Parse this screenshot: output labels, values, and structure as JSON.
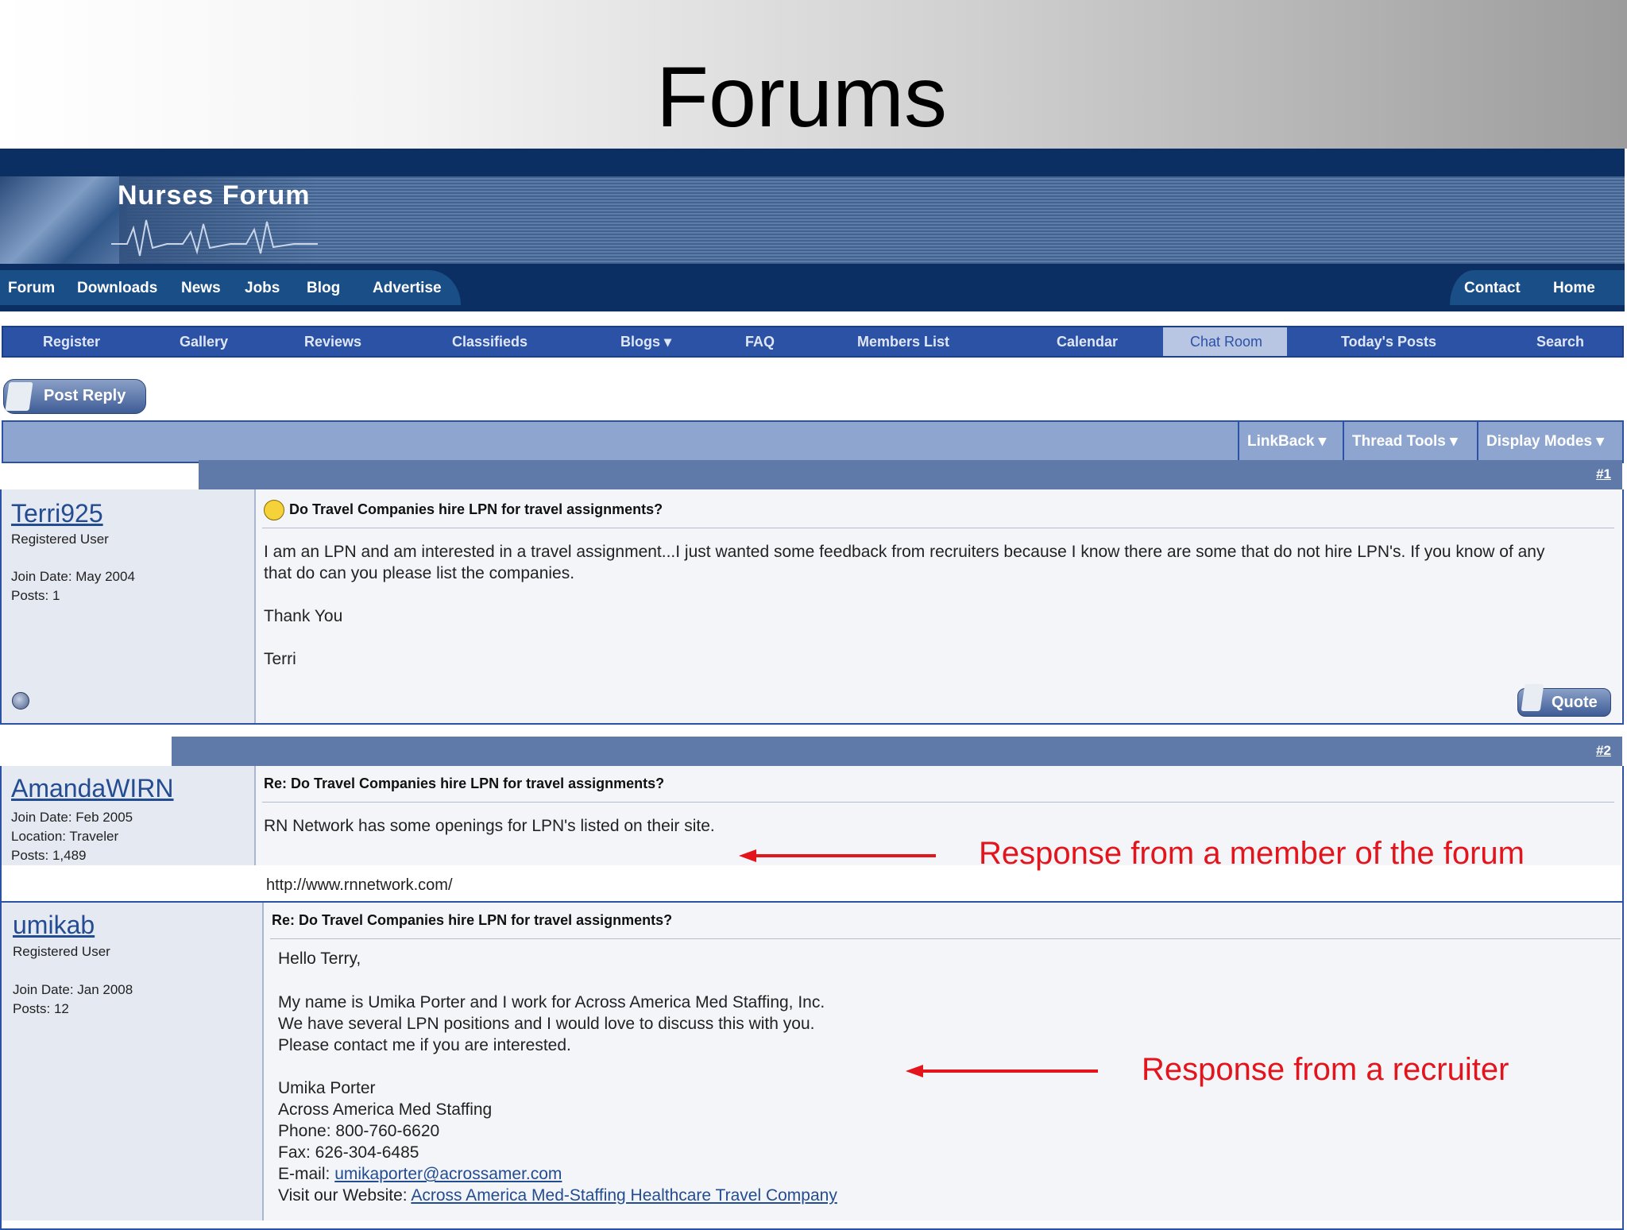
{
  "slide": {
    "title": "Forums"
  },
  "site": {
    "name": "Nurses Forum"
  },
  "nav": {
    "left": [
      "Forum",
      "Downloads",
      "News",
      "Jobs",
      "Blog",
      "Advertise"
    ],
    "right": [
      "Contact",
      "Home"
    ]
  },
  "subnav": [
    "Register",
    "Gallery",
    "Reviews",
    "Classifieds",
    "Blogs ▾",
    "FAQ",
    "Members List",
    "Calendar",
    "Chat Room",
    "Today's Posts",
    "Search"
  ],
  "post_reply_label": "Post Reply",
  "toolbar": {
    "linkback": "LinkBack ▾",
    "thread_tools": "Thread Tools ▾",
    "display_modes": "Display Modes ▾"
  },
  "posts": [
    {
      "number": "#1",
      "user": "Terri925",
      "role": "Registered User",
      "join": "Join Date: May 2004",
      "posts": "Posts: 1",
      "title": "Do Travel Companies hire LPN for travel assignments?",
      "lines": [
        "I am an LPN and am interested in a travel assignment...I just wanted some feedback from recruiters because I know there are some that do not hire LPN's. If you know of any",
        "that do can you please list the companies.",
        "Thank You",
        "Terri"
      ],
      "quote_label": "Quote"
    },
    {
      "number": "#2",
      "user": "AmandaWIRN",
      "join": "Join Date: Feb 2005",
      "location": "Location: Traveler",
      "posts": "Posts: 1,489",
      "title": "Re: Do Travel Companies hire LPN for travel assignments?",
      "lines": [
        "RN Network has some openings for LPN's listed on their site."
      ],
      "url": "http://www.rnnetwork.com/"
    },
    {
      "user": "umikab",
      "role": "Registered User",
      "join": "Join Date: Jan 2008",
      "posts": "Posts: 12",
      "title": "Re: Do Travel Companies hire LPN for travel assignments?",
      "greeting": "Hello Terry,",
      "lines": [
        "My name is Umika Porter and I work for Across America Med Staffing, Inc.",
        "We have several LPN positions and I would love to discuss this with you.",
        "Please contact me if you are interested."
      ],
      "signature": [
        "Umika Porter",
        "Across America Med Staffing",
        "Phone: 800-760-6620",
        "Fax: 626-304-6485"
      ],
      "email_label": "E-mail:",
      "email": "umikaporter@acrossamer.com",
      "website_label": "Visit our Website:",
      "website": "Across America Med-Staffing Healthcare Travel Company"
    }
  ],
  "annotations": {
    "member": "Response from a member of the forum",
    "recruiter": "Response from a recruiter"
  },
  "colors": {
    "annotation": "#e3141b",
    "nav": "#0b2f63",
    "link": "#244c91"
  }
}
